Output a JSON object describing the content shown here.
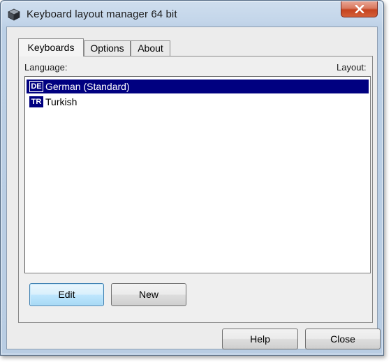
{
  "window": {
    "title": "Keyboard layout manager 64 bit",
    "close_glyph": "X",
    "app_icon": "cube-icon"
  },
  "tabs": [
    {
      "label": "Keyboards",
      "active": true
    },
    {
      "label": "Options",
      "active": false
    },
    {
      "label": "About",
      "active": false
    }
  ],
  "list": {
    "columns": {
      "language": "Language:",
      "layout": "Layout:"
    },
    "items": [
      {
        "code": "DE",
        "name": "German (Standard)",
        "selected": true
      },
      {
        "code": "TR",
        "name": "Turkish",
        "selected": false
      }
    ]
  },
  "panel_buttons": {
    "edit": "Edit",
    "new": "New"
  },
  "dialog_buttons": {
    "help": "Help",
    "close": "Close"
  },
  "colors": {
    "selection": "#000080",
    "close_button": "#c5431f",
    "focused_button": "#bee6fd"
  }
}
